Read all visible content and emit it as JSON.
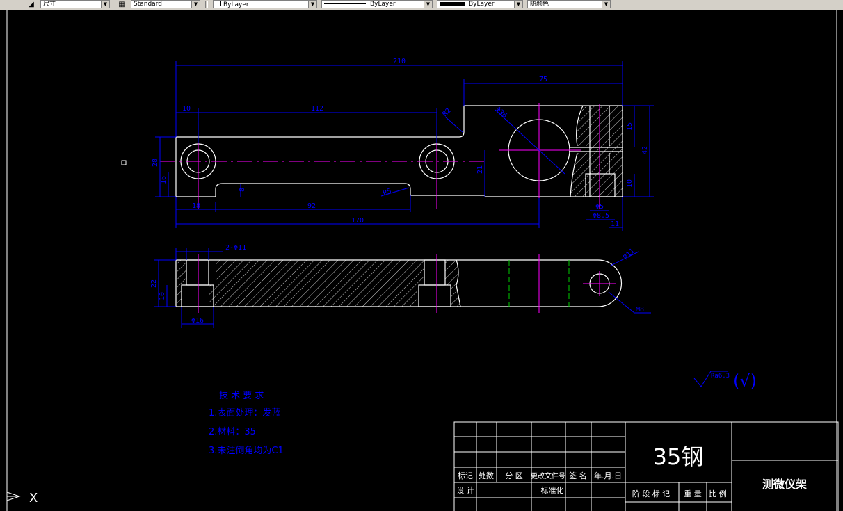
{
  "toolbar": {
    "dimstyle": "尺寸",
    "textstyle": "Standard",
    "layer": "ByLayer",
    "linetype": "ByLayer",
    "lineweight": "ByLayer",
    "color": "随颜色"
  },
  "colors": {
    "outline": "#ffffff",
    "dimension": "#0000ff",
    "center": "#ff00ff",
    "hidden": "#00cc00",
    "background": "#000000"
  },
  "dims": {
    "d210": "210",
    "d75": "75",
    "d10": "10",
    "d112": "112",
    "dR2": "R2",
    "dphi36": "Φ36",
    "d28": "28",
    "d16": "16",
    "d8": "8",
    "d21": "21",
    "dR5": "R5",
    "d18": "18",
    "d92": "92",
    "d170": "170",
    "d15": "15",
    "d42": "42",
    "d10b": "10",
    "dphi5": "Φ5",
    "dphi8": "Φ8.5",
    "d11": "11",
    "d2phi11": "2-Φ11",
    "dR11": "R11",
    "d22": "22",
    "d10c": "10",
    "dphi16": "Φ16",
    "dM8": "M8",
    "ra": "Ra6.3"
  },
  "tech": {
    "title": "技 术 要 求",
    "item1": "1.表面处理：发蓝",
    "item2": "2.材料：35",
    "item3": "3.未注倒角均为C1"
  },
  "title_block": {
    "material": "35钢",
    "part_name": "测微仪架",
    "h_mark": "标记",
    "h_count": "处数",
    "h_zone": "分 区",
    "h_doc": "更改文件号",
    "h_sign": "签 名",
    "h_date": "年.月.日",
    "h_design": "设 计",
    "h_std": "标准化",
    "h_stage": "阶 段 标 记",
    "h_weight": "重 量",
    "h_scale": "比 例"
  },
  "surface_paren": "(√)",
  "ucs_label": "X"
}
